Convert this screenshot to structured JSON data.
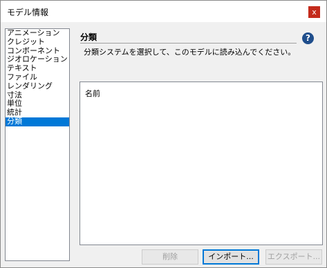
{
  "window": {
    "title": "モデル情報",
    "close_glyph": "x"
  },
  "sidebar": {
    "items": [
      {
        "label": "アニメーション",
        "selected": false
      },
      {
        "label": "クレジット",
        "selected": false
      },
      {
        "label": "コンポーネント",
        "selected": false
      },
      {
        "label": "ジオロケーション",
        "selected": false
      },
      {
        "label": "テキスト",
        "selected": false
      },
      {
        "label": "ファイル",
        "selected": false
      },
      {
        "label": "レンダリング",
        "selected": false
      },
      {
        "label": "寸法",
        "selected": false
      },
      {
        "label": "単位",
        "selected": false
      },
      {
        "label": "統計",
        "selected": false
      },
      {
        "label": "分類",
        "selected": true
      }
    ]
  },
  "panel": {
    "title": "分類",
    "help_glyph": "?",
    "description": "分類システムを選択して、このモデルに読み込んでください。",
    "list_header": "名前"
  },
  "buttons": {
    "delete_label": "削除",
    "import_label": "インポート...",
    "export_label": "エクスポート..."
  },
  "colors": {
    "selection": "#0078d7",
    "close_button": "#c42b1c",
    "help_icon": "#1f4e8c"
  }
}
